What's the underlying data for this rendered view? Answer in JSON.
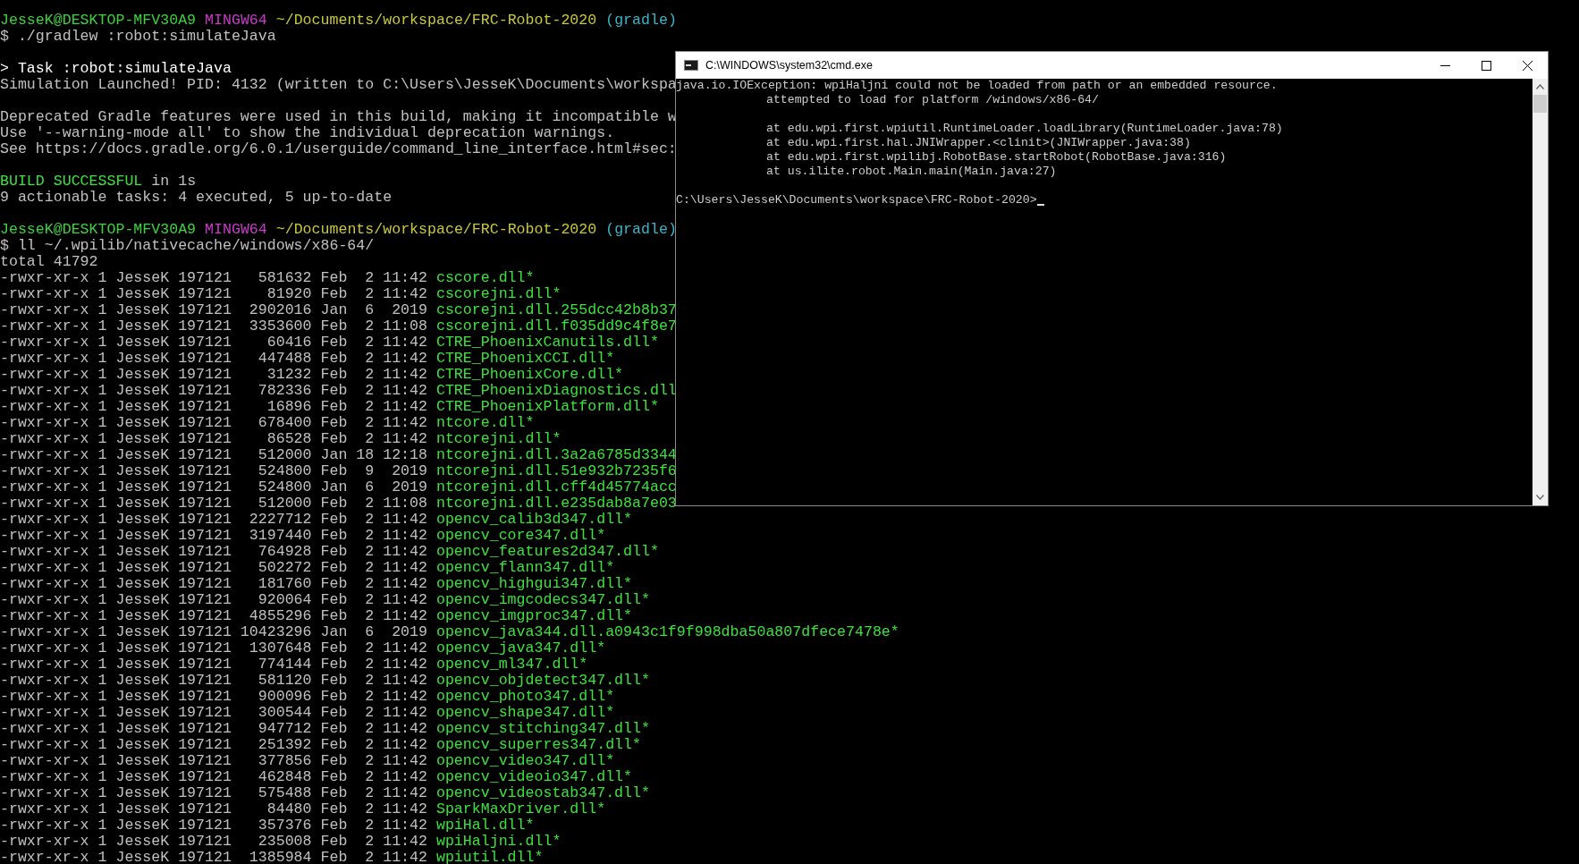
{
  "terminal": {
    "lines": [
      {
        "kind": "prompt",
        "user": "JesseK@DESKTOP-MFV30A9",
        "shell": "MINGW64",
        "path": "~/Documents/workspace/FRC-Robot-2020",
        "branch": "(gradle)"
      },
      {
        "kind": "text",
        "text": "$ ./gradlew :robot:simulateJava"
      },
      {
        "kind": "blank"
      },
      {
        "kind": "task",
        "text": "> Task :robot:simulateJava"
      },
      {
        "kind": "text",
        "text": "Simulation Launched! PID: 4132 (written to C:\\Users\\JesseK\\Documents\\workspa"
      },
      {
        "kind": "blank"
      },
      {
        "kind": "text",
        "text": "Deprecated Gradle features were used in this build, making it incompatible w"
      },
      {
        "kind": "text",
        "text": "Use '--warning-mode all' to show the individual deprecation warnings."
      },
      {
        "kind": "text",
        "text": "See https://docs.gradle.org/6.0.1/userguide/command_line_interface.html#sec:"
      },
      {
        "kind": "blank"
      },
      {
        "kind": "success",
        "status": "BUILD SUCCESSFUL",
        "text": "in 1s"
      },
      {
        "kind": "text",
        "text": "9 actionable tasks: 4 executed, 5 up-to-date"
      },
      {
        "kind": "blank"
      },
      {
        "kind": "prompt",
        "user": "JesseK@DESKTOP-MFV30A9",
        "shell": "MINGW64",
        "path": "~/Documents/workspace/FRC-Robot-2020",
        "branch": "(gradle)"
      },
      {
        "kind": "text",
        "text": "$ ll ~/.wpilib/nativecache/windows/x86-64/"
      },
      {
        "kind": "text",
        "text": "total 41792"
      },
      {
        "kind": "file",
        "meta": "-rwxr-xr-x 1 JesseK 197121   581632 Feb  2 11:42",
        "name": "cscore.dll*"
      },
      {
        "kind": "file",
        "meta": "-rwxr-xr-x 1 JesseK 197121    81920 Feb  2 11:42",
        "name": "cscorejni.dll*"
      },
      {
        "kind": "file",
        "meta": "-rwxr-xr-x 1 JesseK 197121  2902016 Jan  6  2019",
        "name": "cscorejni.dll.255dcc42b8b37"
      },
      {
        "kind": "file",
        "meta": "-rwxr-xr-x 1 JesseK 197121  3353600 Feb  2 11:08",
        "name": "cscorejni.dll.f035dd9c4f8e7"
      },
      {
        "kind": "file",
        "meta": "-rwxr-xr-x 1 JesseK 197121    60416 Feb  2 11:42",
        "name": "CTRE_PhoenixCanutils.dll*"
      },
      {
        "kind": "file",
        "meta": "-rwxr-xr-x 1 JesseK 197121   447488 Feb  2 11:42",
        "name": "CTRE_PhoenixCCI.dll*"
      },
      {
        "kind": "file",
        "meta": "-rwxr-xr-x 1 JesseK 197121    31232 Feb  2 11:42",
        "name": "CTRE_PhoenixCore.dll*"
      },
      {
        "kind": "file",
        "meta": "-rwxr-xr-x 1 JesseK 197121   782336 Feb  2 11:42",
        "name": "CTRE_PhoenixDiagnostics.dll"
      },
      {
        "kind": "file",
        "meta": "-rwxr-xr-x 1 JesseK 197121    16896 Feb  2 11:42",
        "name": "CTRE_PhoenixPlatform.dll*"
      },
      {
        "kind": "file",
        "meta": "-rwxr-xr-x 1 JesseK 197121   678400 Feb  2 11:42",
        "name": "ntcore.dll*"
      },
      {
        "kind": "file",
        "meta": "-rwxr-xr-x 1 JesseK 197121    86528 Feb  2 11:42",
        "name": "ntcorejni.dll*"
      },
      {
        "kind": "file",
        "meta": "-rwxr-xr-x 1 JesseK 197121   512000 Jan 18 12:18",
        "name": "ntcorejni.dll.3a2a6785d3344"
      },
      {
        "kind": "file",
        "meta": "-rwxr-xr-x 1 JesseK 197121   524800 Feb  9  2019",
        "name": "ntcorejni.dll.51e932b7235f6"
      },
      {
        "kind": "file",
        "meta": "-rwxr-xr-x 1 JesseK 197121   524800 Jan  6  2019",
        "name": "ntcorejni.dll.cff4d45774acc"
      },
      {
        "kind": "file",
        "meta": "-rwxr-xr-x 1 JesseK 197121   512000 Feb  2 11:08",
        "name": "ntcorejni.dll.e235dab8a7e03"
      },
      {
        "kind": "file",
        "meta": "-rwxr-xr-x 1 JesseK 197121  2227712 Feb  2 11:42",
        "name": "opencv_calib3d347.dll*"
      },
      {
        "kind": "file",
        "meta": "-rwxr-xr-x 1 JesseK 197121  3197440 Feb  2 11:42",
        "name": "opencv_core347.dll*"
      },
      {
        "kind": "file",
        "meta": "-rwxr-xr-x 1 JesseK 197121   764928 Feb  2 11:42",
        "name": "opencv_features2d347.dll*"
      },
      {
        "kind": "file",
        "meta": "-rwxr-xr-x 1 JesseK 197121   502272 Feb  2 11:42",
        "name": "opencv_flann347.dll*"
      },
      {
        "kind": "file",
        "meta": "-rwxr-xr-x 1 JesseK 197121   181760 Feb  2 11:42",
        "name": "opencv_highgui347.dll*"
      },
      {
        "kind": "file",
        "meta": "-rwxr-xr-x 1 JesseK 197121   920064 Feb  2 11:42",
        "name": "opencv_imgcodecs347.dll*"
      },
      {
        "kind": "file",
        "meta": "-rwxr-xr-x 1 JesseK 197121  4855296 Feb  2 11:42",
        "name": "opencv_imgproc347.dll*"
      },
      {
        "kind": "file",
        "meta": "-rwxr-xr-x 1 JesseK 197121 10423296 Jan  6  2019",
        "name": "opencv_java344.dll.a0943c1f9f998dba50a807dfece7478e*"
      },
      {
        "kind": "file",
        "meta": "-rwxr-xr-x 1 JesseK 197121  1307648 Feb  2 11:42",
        "name": "opencv_java347.dll*"
      },
      {
        "kind": "file",
        "meta": "-rwxr-xr-x 1 JesseK 197121   774144 Feb  2 11:42",
        "name": "opencv_ml347.dll*"
      },
      {
        "kind": "file",
        "meta": "-rwxr-xr-x 1 JesseK 197121   581120 Feb  2 11:42",
        "name": "opencv_objdetect347.dll*"
      },
      {
        "kind": "file",
        "meta": "-rwxr-xr-x 1 JesseK 197121   900096 Feb  2 11:42",
        "name": "opencv_photo347.dll*"
      },
      {
        "kind": "file",
        "meta": "-rwxr-xr-x 1 JesseK 197121   300544 Feb  2 11:42",
        "name": "opencv_shape347.dll*"
      },
      {
        "kind": "file",
        "meta": "-rwxr-xr-x 1 JesseK 197121   947712 Feb  2 11:42",
        "name": "opencv_stitching347.dll*"
      },
      {
        "kind": "file",
        "meta": "-rwxr-xr-x 1 JesseK 197121   251392 Feb  2 11:42",
        "name": "opencv_superres347.dll*"
      },
      {
        "kind": "file",
        "meta": "-rwxr-xr-x 1 JesseK 197121   377856 Feb  2 11:42",
        "name": "opencv_video347.dll*"
      },
      {
        "kind": "file",
        "meta": "-rwxr-xr-x 1 JesseK 197121   462848 Feb  2 11:42",
        "name": "opencv_videoio347.dll*"
      },
      {
        "kind": "file",
        "meta": "-rwxr-xr-x 1 JesseK 197121   575488 Feb  2 11:42",
        "name": "opencv_videostab347.dll*"
      },
      {
        "kind": "file",
        "meta": "-rwxr-xr-x 1 JesseK 197121    84480 Feb  2 11:42",
        "name": "SparkMaxDriver.dll*"
      },
      {
        "kind": "file",
        "meta": "-rwxr-xr-x 1 JesseK 197121   357376 Feb  2 11:42",
        "name": "wpiHal.dll*"
      },
      {
        "kind": "file",
        "meta": "-rwxr-xr-x 1 JesseK 197121   235008 Feb  2 11:42",
        "name": "wpiHaljni.dll*"
      },
      {
        "kind": "file",
        "meta": "-rwxr-xr-x 1 JesseK 197121  1385984 Feb  2 11:42",
        "name": "wpiutil.dll*"
      }
    ]
  },
  "cmd_window": {
    "title": "C:\\WINDOWS\\system32\\cmd.exe",
    "lines": [
      {
        "kind": "text",
        "indented": false,
        "text": "java.io.IOException: wpiHaljni could not be loaded from path or an embedded resource."
      },
      {
        "kind": "text",
        "indented": true,
        "text": "attempted to load for platform /windows/x86-64/"
      },
      {
        "kind": "blank"
      },
      {
        "kind": "text",
        "indented": true,
        "text": "at edu.wpi.first.wpiutil.RuntimeLoader.loadLibrary(RuntimeLoader.java:78)"
      },
      {
        "kind": "text",
        "indented": true,
        "text": "at edu.wpi.first.hal.JNIWrapper.<clinit>(JNIWrapper.java:38)"
      },
      {
        "kind": "text",
        "indented": true,
        "text": "at edu.wpi.first.wpilibj.RobotBase.startRobot(RobotBase.java:316)"
      },
      {
        "kind": "text",
        "indented": true,
        "text": "at us.ilite.robot.Main.main(Main.java:27)"
      },
      {
        "kind": "blank"
      },
      {
        "kind": "prompt",
        "text": "C:\\Users\\JesseK\\Documents\\workspace\\FRC-Robot-2020>"
      }
    ]
  }
}
